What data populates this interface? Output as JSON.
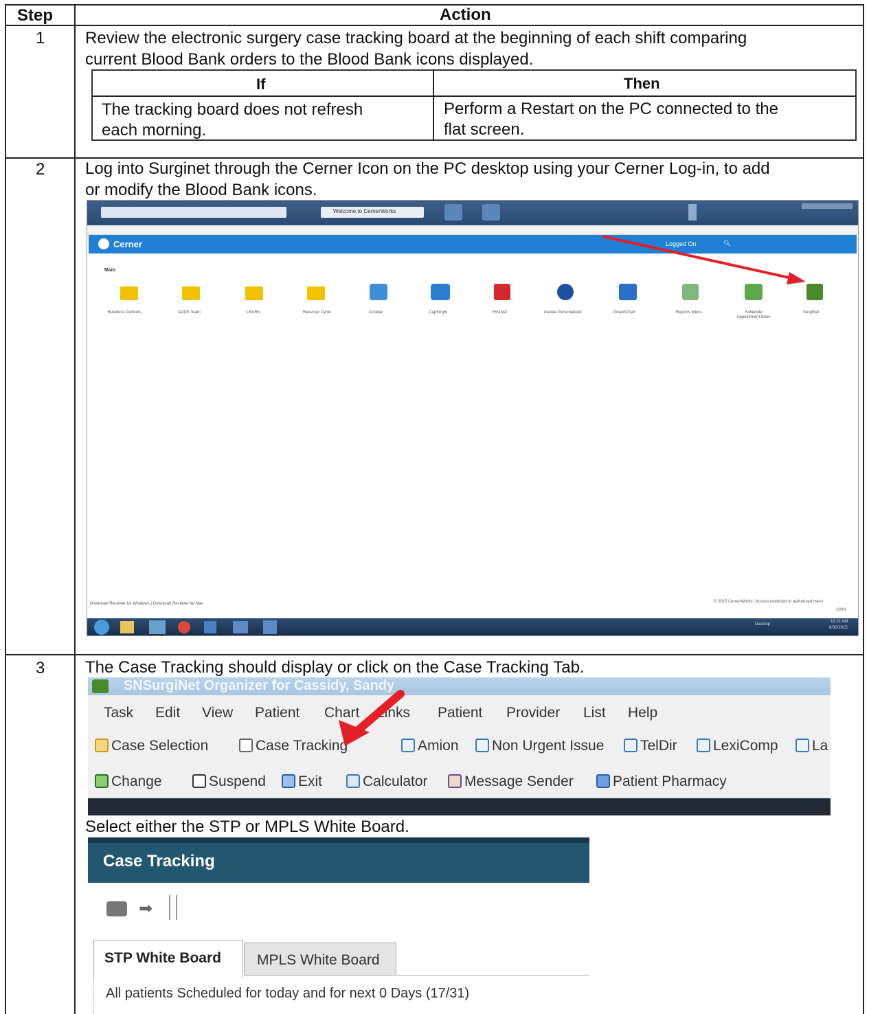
{
  "table": {
    "header_step": "Step",
    "header_action": "Action"
  },
  "step1": {
    "number": "1",
    "text_line1": "Review the electronic surgery case tracking board at the beginning of each shift comparing",
    "text_line2": "current Blood Bank orders to the Blood Bank icons displayed.",
    "if_header": "If",
    "then_header": "Then",
    "if_line1": "The tracking board does not refresh",
    "if_line2": "each morning.",
    "then_line1": "Perform a Restart on the PC connected to the",
    "then_line2": "flat screen."
  },
  "step2": {
    "number": "2",
    "text_line1": "Log into Surginet through the Cerner Icon on the PC desktop using your Cerner Log-in, to add",
    "text_line2": "or modify the Blood Bank icons.",
    "screenshot": {
      "tab_title": "Welcome to CernerWorks",
      "brand": "Cerner",
      "logged_on": "Logged On",
      "section": "Main",
      "apps": [
        {
          "label": "Business Partners",
          "icon": "folder-icon",
          "color": "#f2c200"
        },
        {
          "label": "ADDS Team",
          "icon": "folder-icon",
          "color": "#f2c200"
        },
        {
          "label": "LEARN",
          "icon": "folder-icon",
          "color": "#f2c200"
        },
        {
          "label": "Revenue Cycle",
          "icon": "folder-icon",
          "color": "#f2c200"
        },
        {
          "label": "Accelar",
          "icon": "app-icon",
          "color": "#3d8fd6"
        },
        {
          "label": "CapStrgm",
          "icon": "internet-explorer-icon",
          "color": "#2a7fd0"
        },
        {
          "label": "FirstNet",
          "icon": "firstnet-icon",
          "color": "#d2282e"
        },
        {
          "label": "iAware Personalized",
          "icon": "iaware-icon",
          "color": "#1f4fa0"
        },
        {
          "label": "PowerChart",
          "icon": "powerchart-icon",
          "color": "#2a6fc9"
        },
        {
          "label": "Reports Menu",
          "icon": "reports-icon",
          "color": "#7fb77e"
        },
        {
          "label": "Schedule Appointment Book",
          "icon": "schedule-icon",
          "color": "#5ea84b"
        },
        {
          "label": "SurgiNet",
          "icon": "surginet-icon",
          "color": "#4a8a2a"
        }
      ],
      "footer_left": "Download Receiver for Windows | Download Receiver for Mac",
      "footer_right": "© 2015 CernerWorks | Access restricted to authorized users",
      "zoom": "100%",
      "time": "10:21 AM",
      "date": "6/30/2015",
      "desktop_label": "Desktop"
    }
  },
  "step3": {
    "number": "3",
    "text1": "The Case Tracking should display or click on the Case Tracking Tab.",
    "window_title": "SNSurgiNet Organizer for Cassidy, Sandy",
    "menu": [
      "Task",
      "Edit",
      "View",
      "Patient",
      "Chart",
      "Links",
      "Patient",
      "Provider",
      "List",
      "Help"
    ],
    "toolbar1": [
      "Case Selection",
      "Case Tracking",
      "Amion",
      "Non Urgent Issue",
      "TelDir",
      "LexiComp",
      "La"
    ],
    "toolbar2": [
      "Change",
      "Suspend",
      "Exit",
      "Calculator",
      "Message Sender",
      "Patient Pharmacy"
    ],
    "text2": "Select either the STP or MPLS White Board.",
    "panel_title": "Case Tracking",
    "tab_stp": "STP White Board",
    "tab_mpls": "MPLS White Board",
    "scheduled_text": "All patients Scheduled for today and for next  0 Days (17/31)"
  },
  "colors": {
    "cerner_blue": "#1f80d6",
    "case_tracking_header": "#23566f",
    "arrow_red": "#e32026"
  }
}
